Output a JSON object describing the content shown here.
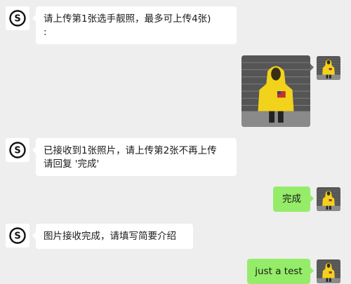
{
  "messages": [
    {
      "from": "bot",
      "text_line1": "请上传第1张选手靓照，最多可上传4张)",
      "text_line2": ":"
    },
    {
      "from": "user",
      "type": "image"
    },
    {
      "from": "bot",
      "text_line1": "已接收到1张照片，请上传第2张不再上传",
      "text_line2": "请回复 '完成'"
    },
    {
      "from": "user",
      "text": "完成"
    },
    {
      "from": "bot",
      "text": "图片接收完成，请填写简要介绍"
    },
    {
      "from": "user",
      "text": "just a test"
    }
  ],
  "bot_logo_letter": "S",
  "colors": {
    "background": "#eeeeee",
    "incoming_bubble": "#ffffff",
    "outgoing_bubble": "#95ec69",
    "hoodie_yellow": "#f2d21b"
  }
}
